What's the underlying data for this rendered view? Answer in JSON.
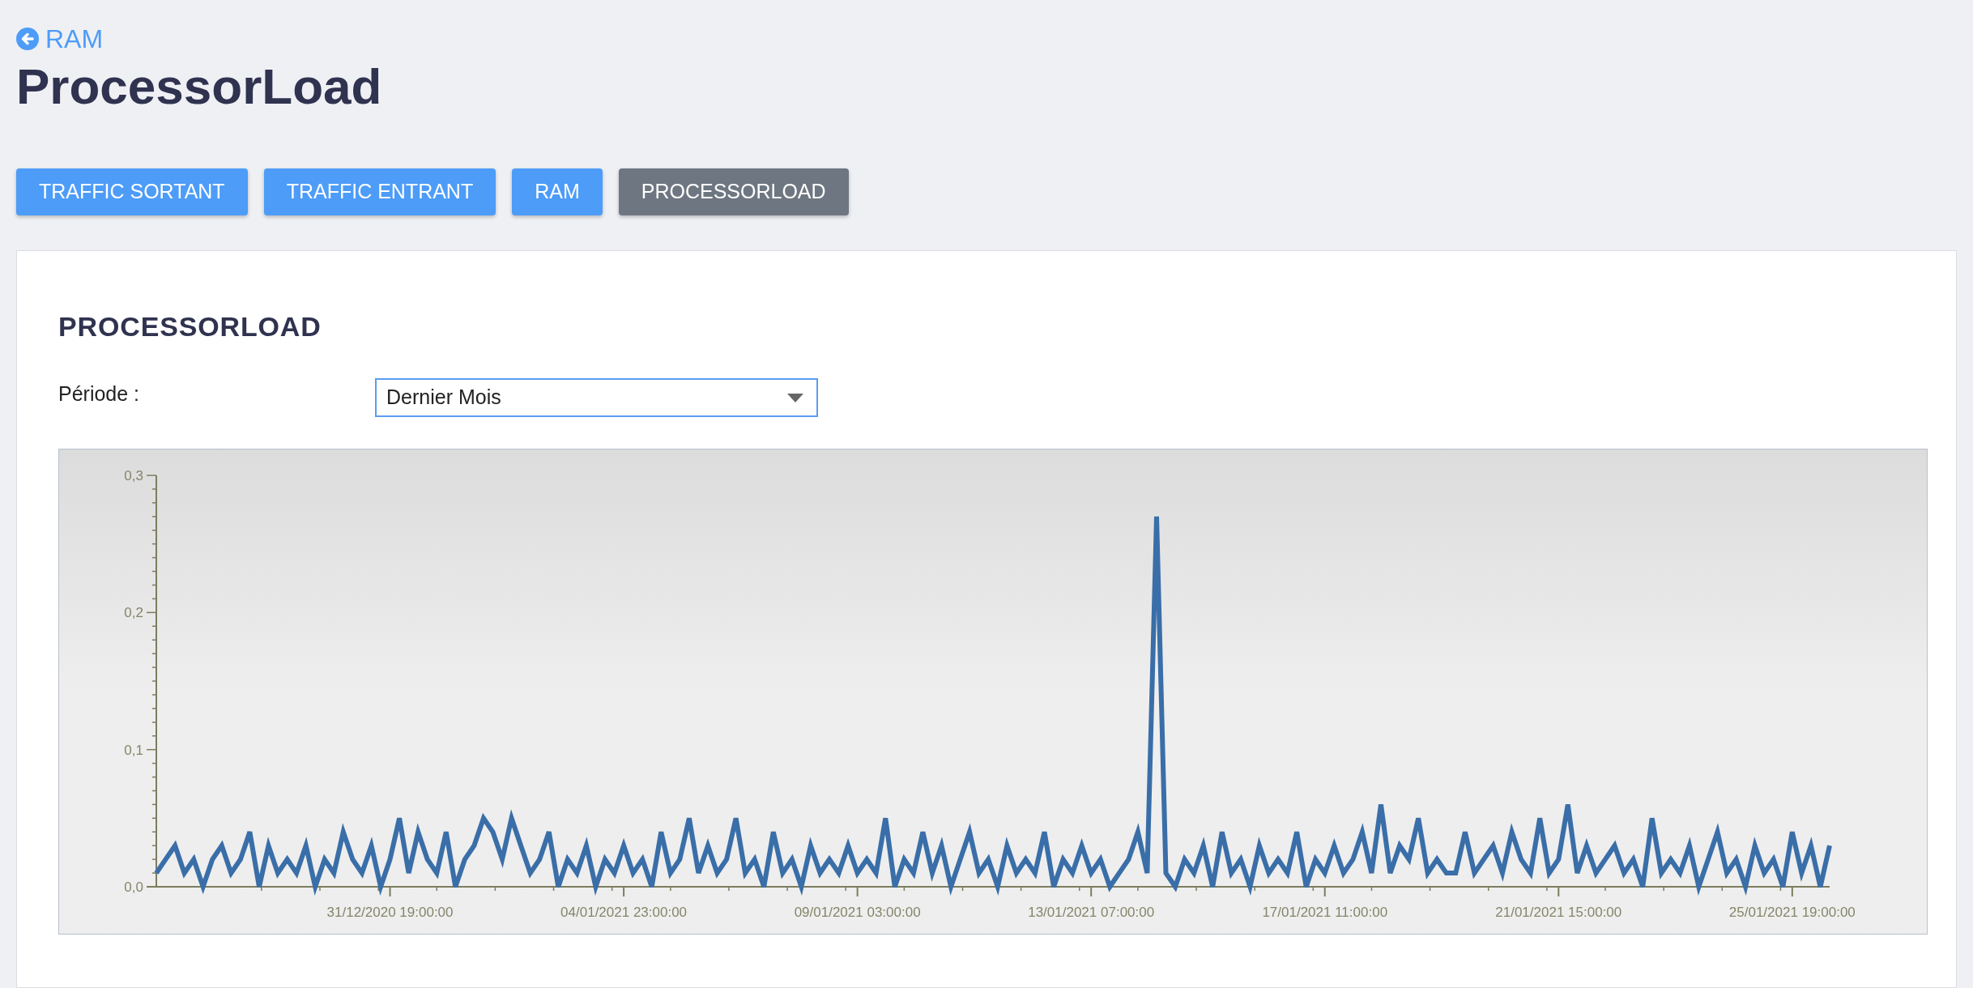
{
  "back_link": {
    "label": "RAM"
  },
  "page_title": "ProcessorLoad",
  "tabs": [
    {
      "label": "TRAFFIC SORTANT",
      "selected": false
    },
    {
      "label": "TRAFFIC ENTRANT",
      "selected": false
    },
    {
      "label": "RAM",
      "selected": false
    },
    {
      "label": "PROCESSORLOAD",
      "selected": true
    }
  ],
  "card": {
    "title": "PROCESSORLOAD",
    "period": {
      "label": "Période :",
      "value": "Dernier Mois"
    },
    "chart_data": {
      "type": "line",
      "categories": [
        null,
        null,
        null,
        null,
        null,
        null,
        null,
        null,
        null,
        null,
        null,
        null,
        null,
        null,
        null,
        null,
        null,
        null,
        null,
        null,
        null,
        null,
        null,
        null,
        null,
        "31/12/2020 19:00:00",
        null,
        null,
        null,
        null,
        null,
        null,
        null,
        null,
        null,
        null,
        null,
        null,
        null,
        null,
        null,
        null,
        null,
        null,
        null,
        null,
        null,
        null,
        null,
        null,
        "04/01/2021 23:00:00",
        null,
        null,
        null,
        null,
        null,
        null,
        null,
        null,
        null,
        null,
        null,
        null,
        null,
        null,
        null,
        null,
        null,
        null,
        null,
        null,
        null,
        null,
        null,
        null,
        "09/01/2021 03:00:00",
        null,
        null,
        null,
        null,
        null,
        null,
        null,
        null,
        null,
        null,
        null,
        null,
        null,
        null,
        null,
        null,
        null,
        null,
        null,
        null,
        null,
        null,
        null,
        null,
        "13/01/2021 07:00:00",
        null,
        null,
        null,
        null,
        null,
        null,
        null,
        null,
        null,
        null,
        null,
        null,
        null,
        null,
        null,
        null,
        null,
        null,
        null,
        null,
        null,
        null,
        null,
        null,
        "17/01/2021 11:00:00",
        null,
        null,
        null,
        null,
        null,
        null,
        null,
        null,
        null,
        null,
        null,
        null,
        null,
        null,
        null,
        null,
        null,
        null,
        null,
        null,
        null,
        null,
        null,
        null,
        "21/01/2021 15:00:00",
        null,
        null,
        null,
        null,
        null,
        null,
        null,
        null,
        null,
        null,
        null,
        null,
        null,
        null,
        null,
        null,
        null,
        null,
        null,
        null,
        null,
        null,
        null,
        null,
        "25/01/2021 19:00:00",
        null,
        null,
        null,
        null
      ],
      "ylim": [
        0,
        0.3
      ],
      "yticks": [
        {
          "value": 0,
          "label": "0,0"
        },
        {
          "value": 0.1,
          "label": "0,1"
        },
        {
          "value": 0.2,
          "label": "0,2"
        },
        {
          "value": 0.3,
          "label": "0,3"
        }
      ],
      "series": [
        {
          "color": "#3a6ea8",
          "values": [
            0.01,
            0.02,
            0.03,
            0.01,
            0.02,
            0.0,
            0.02,
            0.03,
            0.01,
            0.02,
            0.04,
            0.0,
            0.03,
            0.01,
            0.02,
            0.01,
            0.03,
            0.0,
            0.02,
            0.01,
            0.04,
            0.02,
            0.01,
            0.03,
            0.0,
            0.02,
            0.05,
            0.01,
            0.04,
            0.02,
            0.01,
            0.04,
            0.0,
            0.02,
            0.03,
            0.05,
            0.04,
            0.02,
            0.05,
            0.03,
            0.01,
            0.02,
            0.04,
            0.0,
            0.02,
            0.01,
            0.03,
            0.0,
            0.02,
            0.01,
            0.03,
            0.01,
            0.02,
            0.0,
            0.04,
            0.01,
            0.02,
            0.05,
            0.01,
            0.03,
            0.01,
            0.02,
            0.05,
            0.01,
            0.02,
            0.0,
            0.04,
            0.01,
            0.02,
            0.0,
            0.03,
            0.01,
            0.02,
            0.01,
            0.03,
            0.01,
            0.02,
            0.01,
            0.05,
            0.0,
            0.02,
            0.01,
            0.04,
            0.01,
            0.03,
            0.0,
            0.02,
            0.04,
            0.01,
            0.02,
            0.0,
            0.03,
            0.01,
            0.02,
            0.01,
            0.04,
            0.0,
            0.02,
            0.01,
            0.03,
            0.01,
            0.02,
            0.0,
            0.01,
            0.02,
            0.04,
            0.01,
            0.27,
            0.01,
            0.0,
            0.02,
            0.01,
            0.03,
            0.0,
            0.04,
            0.01,
            0.02,
            0.0,
            0.03,
            0.01,
            0.02,
            0.01,
            0.04,
            0.0,
            0.02,
            0.01,
            0.03,
            0.01,
            0.02,
            0.04,
            0.01,
            0.06,
            0.01,
            0.03,
            0.02,
            0.05,
            0.01,
            0.02,
            0.01,
            0.01,
            0.04,
            0.01,
            0.02,
            0.03,
            0.01,
            0.04,
            0.02,
            0.01,
            0.05,
            0.01,
            0.02,
            0.06,
            0.01,
            0.03,
            0.01,
            0.02,
            0.03,
            0.01,
            0.02,
            0.0,
            0.05,
            0.01,
            0.02,
            0.01,
            0.03,
            0.0,
            0.02,
            0.04,
            0.01,
            0.02,
            0.0,
            0.03,
            0.01,
            0.02,
            0.0,
            0.04,
            0.01,
            0.03,
            0.0,
            0.03
          ]
        }
      ]
    }
  }
}
